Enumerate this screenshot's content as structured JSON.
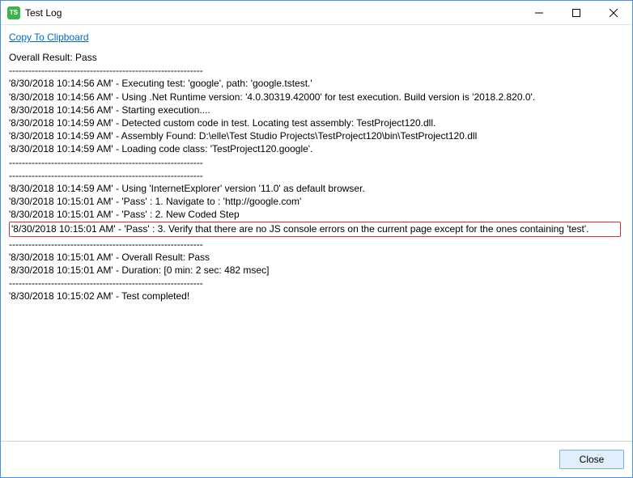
{
  "window": {
    "title": "Test Log",
    "icon_text": "TS"
  },
  "toolbar": {
    "copy_label": "Copy To Clipboard"
  },
  "log": {
    "separator": "------------------------------------------------------------",
    "overall": "Overall Result: Pass",
    "lines": [
      "'8/30/2018 10:14:56 AM' - Executing test: 'google', path: 'google.tstest.'",
      "'8/30/2018 10:14:56 AM' - Using .Net Runtime version: '4.0.30319.42000' for test execution. Build version is '2018.2.820.0'.",
      "'8/30/2018 10:14:56 AM' - Starting execution....",
      "'8/30/2018 10:14:59 AM' - Detected custom code in test. Locating test assembly: TestProject120.dll.",
      "'8/30/2018 10:14:59 AM' - Assembly Found: D:\\elle\\Test Studio Projects\\TestProject120\\bin\\TestProject120.dll",
      "'8/30/2018 10:14:59 AM' - Loading code class: 'TestProject120.google'."
    ],
    "lines2": [
      "'8/30/2018 10:14:59 AM' - Using 'InternetExplorer' version '11.0' as default browser.",
      "'8/30/2018 10:15:01 AM' - 'Pass' : 1. Navigate to : 'http://google.com'",
      "'8/30/2018 10:15:01 AM' - 'Pass' : 2. New Coded Step"
    ],
    "highlight": "'8/30/2018 10:15:01 AM' - 'Pass' : 3. Verify that there are no JS console errors on the current page except for the ones containing 'test'.",
    "lines3": [
      "'8/30/2018 10:15:01 AM' - Overall Result: Pass",
      "'8/30/2018 10:15:01 AM' - Duration: [0 min: 2 sec: 482 msec]"
    ],
    "lines4": [
      "'8/30/2018 10:15:02 AM' - Test completed!"
    ]
  },
  "footer": {
    "close_label": "Close"
  }
}
